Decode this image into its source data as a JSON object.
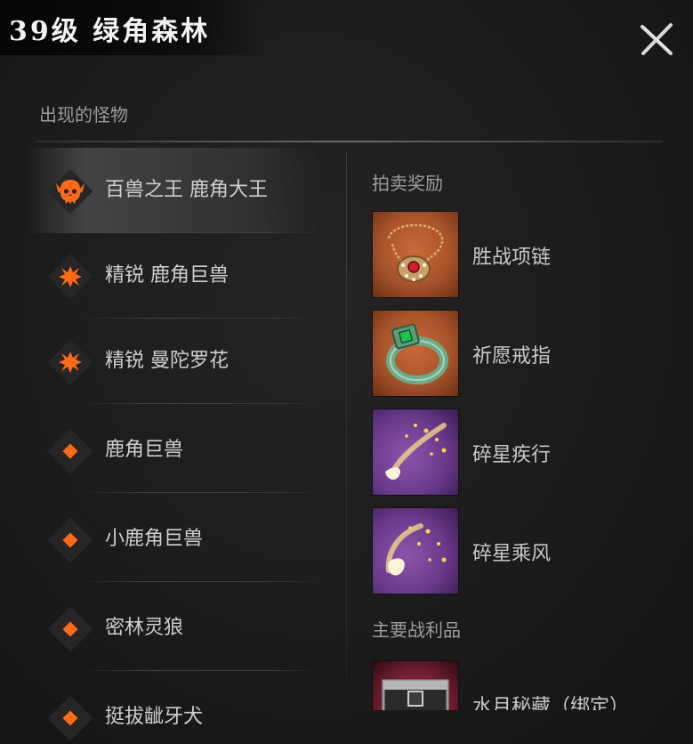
{
  "header": {
    "title": "39级 绿角森林"
  },
  "monsters": {
    "section_title": "出现的怪物",
    "items": [
      {
        "name": "百兽之王 鹿角大王",
        "rank": "boss",
        "selected": true
      },
      {
        "name": "精锐 鹿角巨兽",
        "rank": "elite"
      },
      {
        "name": "精锐 曼陀罗花",
        "rank": "elite"
      },
      {
        "name": "鹿角巨兽",
        "rank": "normal"
      },
      {
        "name": "小鹿角巨兽",
        "rank": "normal"
      },
      {
        "name": "密林灵狼",
        "rank": "normal"
      },
      {
        "name": "挺拔龇牙犬",
        "rank": "normal"
      }
    ]
  },
  "auction": {
    "section_title": "拍卖奖励",
    "items": [
      {
        "name": "胜战项链",
        "icon": "necklace-icon",
        "bg": "#a8542a"
      },
      {
        "name": "祈愿戒指",
        "icon": "ring-icon",
        "bg": "#a8542a"
      },
      {
        "name": "碎星疾行",
        "icon": "shooting-star-icon",
        "bg": "#6b3a8c"
      },
      {
        "name": "碎星乘风",
        "icon": "shooting-star-icon",
        "bg": "#6b3a8c"
      }
    ]
  },
  "loot": {
    "section_title": "主要战利品",
    "items": [
      {
        "name": "水月秘藏（绑定）",
        "icon": "treasure-chest-icon",
        "bg": "#6a1c2c"
      }
    ]
  },
  "colors": {
    "accent": "#ff6a1a",
    "text": "#cfcfcf",
    "muted": "#9c9c9c"
  }
}
